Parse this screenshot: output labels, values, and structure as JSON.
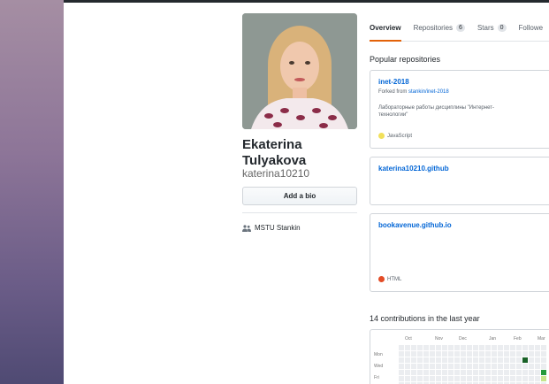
{
  "profile": {
    "full_name": "Ekaterina Tulyakova",
    "username": "katerina10210",
    "add_bio_label": "Add a bio",
    "organization": "MSTU Stankin"
  },
  "tabs": [
    {
      "label": "Overview",
      "count": null
    },
    {
      "label": "Repositories",
      "count": "6"
    },
    {
      "label": "Stars",
      "count": "0"
    },
    {
      "label": "Followe",
      "count": null
    }
  ],
  "popular": {
    "heading": "Popular repositories",
    "repos": [
      {
        "name": "inet-2018",
        "forked_prefix": "Forked from",
        "forked_from": "stankin/inet-2018",
        "description": "Лабораторные работы дисциплины \"Интернет-технологии\"",
        "language": "JavaScript",
        "language_color": "#f1e05a"
      },
      {
        "name": "katerina10210.github",
        "forked_prefix": "",
        "forked_from": "",
        "description": "",
        "language": "",
        "language_color": ""
      },
      {
        "name": "bookavenue.github.io",
        "forked_prefix": "",
        "forked_from": "",
        "description": "",
        "language": "HTML",
        "language_color": "#e34c26"
      }
    ]
  },
  "contributions": {
    "heading": "14 contributions in the last year",
    "months": [
      "Oct",
      "Nov",
      "Dec",
      "Jan",
      "Feb",
      "Mar"
    ],
    "days": [
      "Mon",
      "Wed",
      "Fri"
    ],
    "colors": {
      "empty": "#ebedf0",
      "level1": "#c6e48b",
      "level3": "#239a3b",
      "level4": "#196127"
    }
  },
  "colors": {
    "accent_tab": "#e36209",
    "link": "#0366d6"
  }
}
